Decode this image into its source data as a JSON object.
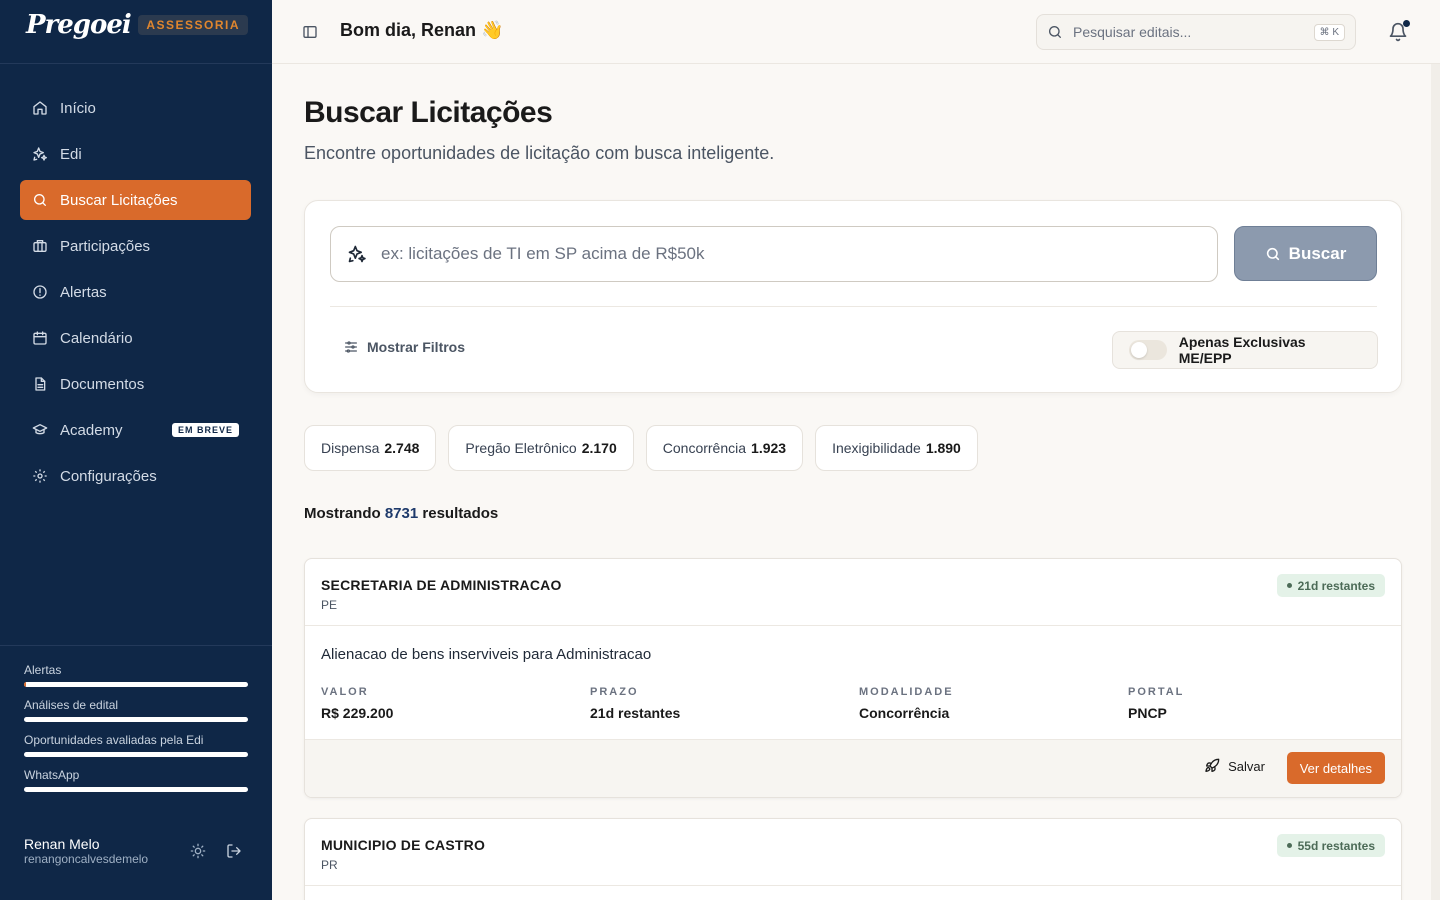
{
  "sidebar": {
    "brand": "Pregoei",
    "badge": "ASSESSORIA",
    "items": [
      {
        "label": "Início",
        "icon": "home-icon",
        "active": false
      },
      {
        "label": "Edi",
        "icon": "sparkles-icon",
        "active": false
      },
      {
        "label": "Buscar Licitações",
        "icon": "search-icon",
        "active": true
      },
      {
        "label": "Participações",
        "icon": "briefcase-icon",
        "active": false
      },
      {
        "label": "Alertas",
        "icon": "alert-circle-icon",
        "active": false
      },
      {
        "label": "Calendário",
        "icon": "calendar-icon",
        "active": false
      },
      {
        "label": "Documentos",
        "icon": "document-icon",
        "active": false
      },
      {
        "label": "Academy",
        "icon": "graduation-cap-icon",
        "active": false,
        "badge": "EM BREVE"
      },
      {
        "label": "Configurações",
        "icon": "gear-icon",
        "active": false
      }
    ],
    "usage": [
      {
        "label": "Alertas",
        "fill": 0.01
      },
      {
        "label": "Análises de edital",
        "fill": 0
      },
      {
        "label": "Oportunidades avaliadas pela Edi",
        "fill": 0
      },
      {
        "label": "WhatsApp",
        "fill": 0
      }
    ],
    "user": {
      "name": "Renan Melo",
      "email": "renangoncalvesdemelo"
    }
  },
  "header": {
    "greeting": "Bom dia, Renan 👋",
    "search_placeholder": "Pesquisar editais...",
    "shortcut": "⌘ K"
  },
  "main": {
    "title": "Buscar Licitações",
    "subtitle": "Encontre oportunidades de licitação com busca inteligente.",
    "search": {
      "placeholder": "ex: licitações de TI em SP acima de R$50k",
      "button": "Buscar",
      "filters": "Mostrar Filtros",
      "toggle_label": "Apenas Exclusivas ME/EPP"
    },
    "chips": [
      {
        "label": "Dispensa",
        "count": "2.748"
      },
      {
        "label": "Pregão Eletrônico",
        "count": "2.170"
      },
      {
        "label": "Concorrência",
        "count": "1.923"
      },
      {
        "label": "Inexigibilidade",
        "count": "1.890"
      }
    ],
    "results": {
      "prefix": "Mostrando",
      "count": "8731",
      "suffix": "resultados"
    },
    "cards": [
      {
        "org": "SECRETARIA DE ADMINISTRACAO",
        "uf": "PE",
        "badge": "21d restantes",
        "description": "Alienacao de bens inserviveis para Administracao",
        "fields": [
          {
            "key": "VALOR",
            "value": "R$ 229.200"
          },
          {
            "key": "PRAZO",
            "value": "21d restantes"
          },
          {
            "key": "MODALIDADE",
            "value": "Concorrência"
          },
          {
            "key": "PORTAL",
            "value": "PNCP"
          }
        ],
        "save": "Salvar",
        "details": "Ver detalhes"
      },
      {
        "org": "MUNICIPIO DE CASTRO",
        "uf": "PR",
        "badge": "55d restantes"
      }
    ]
  }
}
